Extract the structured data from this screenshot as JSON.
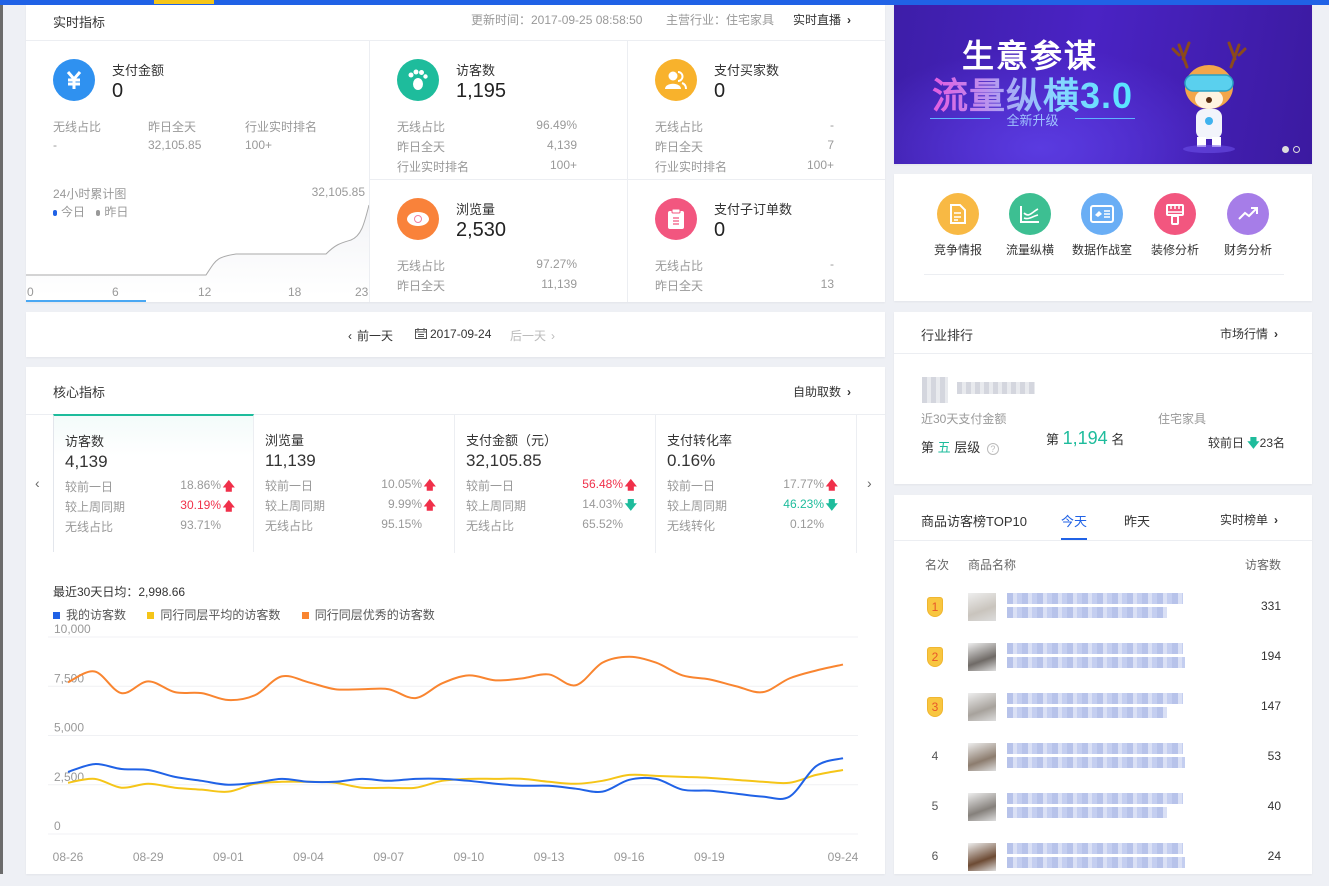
{
  "realtime": {
    "title": "实时指标",
    "update_time": "更新时间：2017-09-25 08:58:50",
    "industry": "主营行业：住宅家具",
    "live_link": "实时直播",
    "pay_amount": {
      "label": "支付金额",
      "value": "0",
      "cols": [
        {
          "label": "无线占比",
          "value": "-"
        },
        {
          "label": "昨日全天",
          "value": "32,105.85"
        },
        {
          "label": "行业实时排名",
          "value": "100+"
        }
      ],
      "chart_title": "24小时累计图",
      "chart_max_label": "32,105.85",
      "legend": [
        "今日",
        "昨日"
      ],
      "x_ticks": [
        "0",
        "6",
        "12",
        "18",
        "23"
      ]
    },
    "visitors": {
      "label": "访客数",
      "value": "1,195",
      "rows": [
        {
          "label": "无线占比",
          "value": "96.49%"
        },
        {
          "label": "昨日全天",
          "value": "4,139"
        },
        {
          "label": "行业实时排名",
          "value": "100+"
        }
      ]
    },
    "buyers": {
      "label": "支付买家数",
      "value": "0",
      "rows": [
        {
          "label": "无线占比",
          "value": "-"
        },
        {
          "label": "昨日全天",
          "value": "7"
        },
        {
          "label": "行业实时排名",
          "value": "100+"
        }
      ]
    },
    "pageviews": {
      "label": "浏览量",
      "value": "2,530",
      "rows": [
        {
          "label": "无线占比",
          "value": "97.27%"
        },
        {
          "label": "昨日全天",
          "value": "11,139"
        }
      ]
    },
    "sub_orders": {
      "label": "支付子订单数",
      "value": "0",
      "rows": [
        {
          "label": "无线占比",
          "value": "-"
        },
        {
          "label": "昨日全天",
          "value": "13"
        }
      ]
    }
  },
  "datenav": {
    "prev": "前一天",
    "date": "2017-09-24",
    "next": "后一天"
  },
  "core": {
    "title": "核心指标",
    "self_service": "自助取数",
    "tabs": [
      {
        "title": "访客数",
        "value": "4,139",
        "rows": [
          {
            "label": "较前一日",
            "value": "18.86%",
            "dir": "up",
            "color": "normal"
          },
          {
            "label": "较上周同期",
            "value": "30.19%",
            "dir": "up",
            "color": "red"
          },
          {
            "label": "无线占比",
            "value": "93.71%",
            "dir": "",
            "color": "normal"
          }
        ]
      },
      {
        "title": "浏览量",
        "value": "11,139",
        "rows": [
          {
            "label": "较前一日",
            "value": "10.05%",
            "dir": "up",
            "color": "normal"
          },
          {
            "label": "较上周同期",
            "value": "9.99%",
            "dir": "up",
            "color": "normal"
          },
          {
            "label": "无线占比",
            "value": "95.15%",
            "dir": "",
            "color": "normal"
          }
        ]
      },
      {
        "title": "支付金额（元）",
        "value": "32,105.85",
        "rows": [
          {
            "label": "较前一日",
            "value": "56.48%",
            "dir": "up",
            "color": "red"
          },
          {
            "label": "较上周同期",
            "value": "14.03%",
            "dir": "down",
            "color": "normal"
          },
          {
            "label": "无线占比",
            "value": "65.52%",
            "dir": "",
            "color": "normal"
          }
        ]
      },
      {
        "title": "支付转化率",
        "value": "0.16%",
        "rows": [
          {
            "label": "较前一日",
            "value": "17.77%",
            "dir": "up",
            "color": "normal"
          },
          {
            "label": "较上周同期",
            "value": "46.23%",
            "dir": "down",
            "color": "green"
          },
          {
            "label": "无线转化",
            "value": "0.12%",
            "dir": "",
            "color": "normal"
          }
        ]
      }
    ],
    "summary": "最近30天日均：2,998.66"
  },
  "chart_data": {
    "type": "line",
    "title": "",
    "xlabel": "",
    "ylabel": "",
    "ylim": [
      0,
      10000
    ],
    "y_ticks": [
      "0",
      "2,500",
      "5,000",
      "7,500",
      "10,000"
    ],
    "y_tick_values": [
      0,
      2500,
      5000,
      7500,
      10000
    ],
    "x_tick_labels": [
      "08-26",
      "08-29",
      "09-01",
      "09-04",
      "09-07",
      "09-10",
      "09-13",
      "09-16",
      "09-19",
      "09-24"
    ],
    "x": [
      "08-26",
      "08-27",
      "08-28",
      "08-29",
      "08-30",
      "08-31",
      "09-01",
      "09-02",
      "09-03",
      "09-04",
      "09-05",
      "09-06",
      "09-07",
      "09-08",
      "09-09",
      "09-10",
      "09-11",
      "09-12",
      "09-13",
      "09-14",
      "09-15",
      "09-16",
      "09-17",
      "09-18",
      "09-19",
      "09-20",
      "09-21",
      "09-22",
      "09-23",
      "09-24"
    ],
    "grid": true,
    "legend_position": "top-left",
    "series": [
      {
        "name": "我的访客数",
        "color": "#2062e6",
        "values": [
          3150,
          3550,
          3300,
          3250,
          2900,
          2700,
          2500,
          2600,
          2800,
          2650,
          2650,
          2800,
          2700,
          2800,
          2800,
          2700,
          2550,
          2450,
          2450,
          2300,
          2150,
          2750,
          2800,
          2250,
          2200,
          2050,
          1900,
          1900,
          3450,
          3850
        ]
      },
      {
        "name": "同行同层平均的访客数",
        "color": "#f5c518",
        "values": [
          2600,
          2800,
          2350,
          2550,
          2350,
          2250,
          2150,
          2550,
          2650,
          2650,
          2600,
          2350,
          2350,
          2350,
          2700,
          2800,
          2800,
          2800,
          2650,
          2550,
          2700,
          3000,
          2950,
          2900,
          2850,
          2750,
          2650,
          2600,
          3000,
          3250
        ]
      },
      {
        "name": "同行同层优秀的访客数",
        "color": "#f98530",
        "values": [
          7700,
          8250,
          7150,
          7750,
          7200,
          7150,
          6800,
          7050,
          8000,
          7700,
          7350,
          7350,
          7350,
          6900,
          7650,
          8050,
          7800,
          7900,
          8100,
          7550,
          8700,
          9000,
          8700,
          8050,
          7850,
          7500,
          7200,
          7900,
          8300,
          8600
        ]
      }
    ]
  },
  "banner": {
    "line1": "生意参谋",
    "line2": "流量纵横3.0",
    "line3": "全新升级"
  },
  "shortcuts": [
    {
      "label": "竞争情报",
      "icon": "report-icon",
      "color": "#f8b944"
    },
    {
      "label": "流量纵横",
      "icon": "traffic-chart-icon",
      "color": "#3dbf92"
    },
    {
      "label": "数据作战室",
      "icon": "data-room-icon",
      "color": "#6aaef5"
    },
    {
      "label": "装修分析",
      "icon": "brush-icon",
      "color": "#f2567f"
    },
    {
      "label": "财务分析",
      "icon": "trend-icon",
      "color": "#a67de8"
    }
  ],
  "industry_rank": {
    "title": "行业排行",
    "market_link": "市场行情",
    "metric": "近30天支付金额",
    "category": "住宅家具",
    "tier_prefix": "第",
    "tier": "五",
    "tier_suffix": "层级",
    "rank_prefix": "第",
    "rank": "1,194",
    "rank_suffix": "名",
    "change_label": "较前日",
    "change_value": "23名"
  },
  "top10": {
    "title": "商品访客榜TOP10",
    "tabs": [
      "今天",
      "昨天"
    ],
    "live_link": "实时榜单",
    "columns": [
      "名次",
      "商品名称",
      "访客数"
    ],
    "rows": [
      {
        "rank": "1",
        "visitors": "331"
      },
      {
        "rank": "2",
        "visitors": "194"
      },
      {
        "rank": "3",
        "visitors": "147"
      },
      {
        "rank": "4",
        "visitors": "53"
      },
      {
        "rank": "5",
        "visitors": "40"
      },
      {
        "rank": "6",
        "visitors": "24"
      }
    ]
  },
  "colors": {
    "accent_blue": "#2062e6",
    "teal": "#1ebc9c",
    "red": "#f0304a",
    "orange": "#f98530",
    "yellow": "#f5c518"
  }
}
